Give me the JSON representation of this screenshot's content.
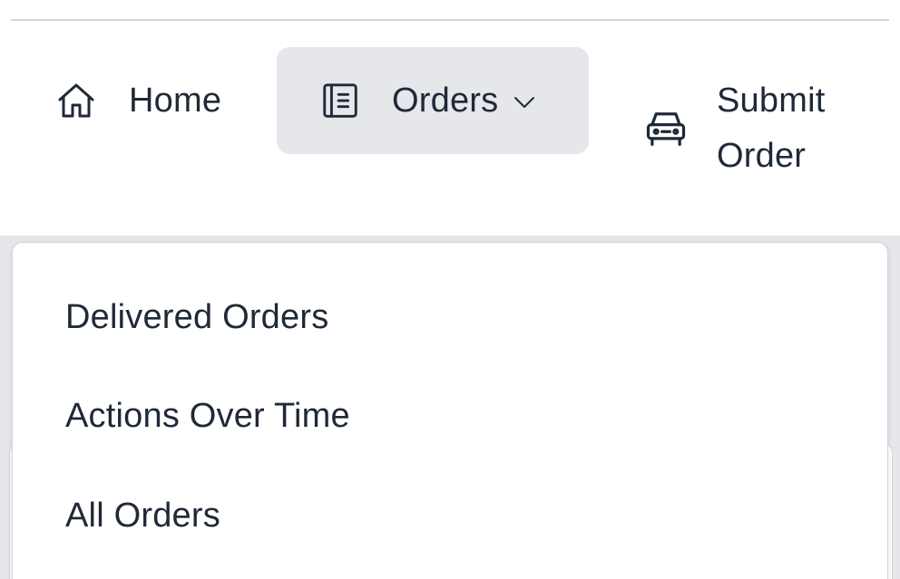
{
  "nav": {
    "items": [
      {
        "label": "Home",
        "icon": "home-icon"
      },
      {
        "label": "Orders",
        "icon": "notebook-icon",
        "active": true,
        "has_dropdown": true
      },
      {
        "label": "Submit Order",
        "icon": "car-icon"
      }
    ]
  },
  "orders_menu": {
    "items": [
      {
        "label": "Delivered Orders"
      },
      {
        "label": "Actions Over Time"
      },
      {
        "label": "All Orders"
      }
    ]
  },
  "colors": {
    "text": "#1f2937",
    "active_bg": "#e5e7eb",
    "border": "#d1d5db",
    "backdrop": "#e5e7eb"
  }
}
